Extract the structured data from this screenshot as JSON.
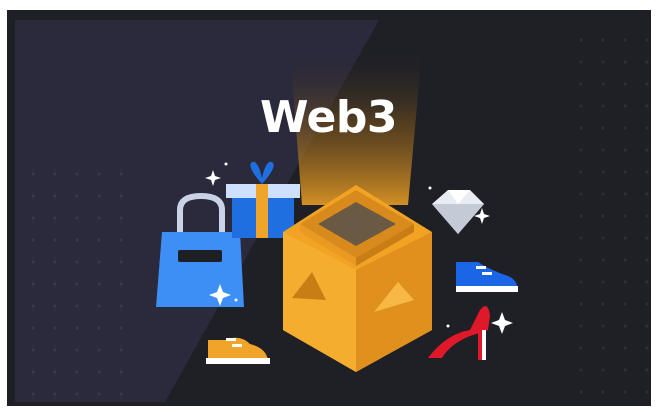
{
  "banner": {
    "title": "Web3",
    "colors": {
      "background": "#1f2026",
      "panel": "#2a2a3c",
      "cube_light": "#f2a324",
      "cube_dark": "#d9861a",
      "bag_blue": "#3d8ff5",
      "gift_blue": "#1f6fe0",
      "ribbon_orange": "#f0a42a",
      "shoe_blue": "#1a66e6",
      "heel_red": "#e0192a",
      "sneaker_orange": "#f0a42a",
      "sparkle": "#ffffff"
    },
    "icons": [
      "shopping-bag-icon",
      "gift-box-icon",
      "diamond-icon",
      "blue-sneaker-icon",
      "red-heel-icon",
      "orange-sneaker-icon",
      "treasure-cube-icon",
      "sparkle-icon"
    ]
  }
}
